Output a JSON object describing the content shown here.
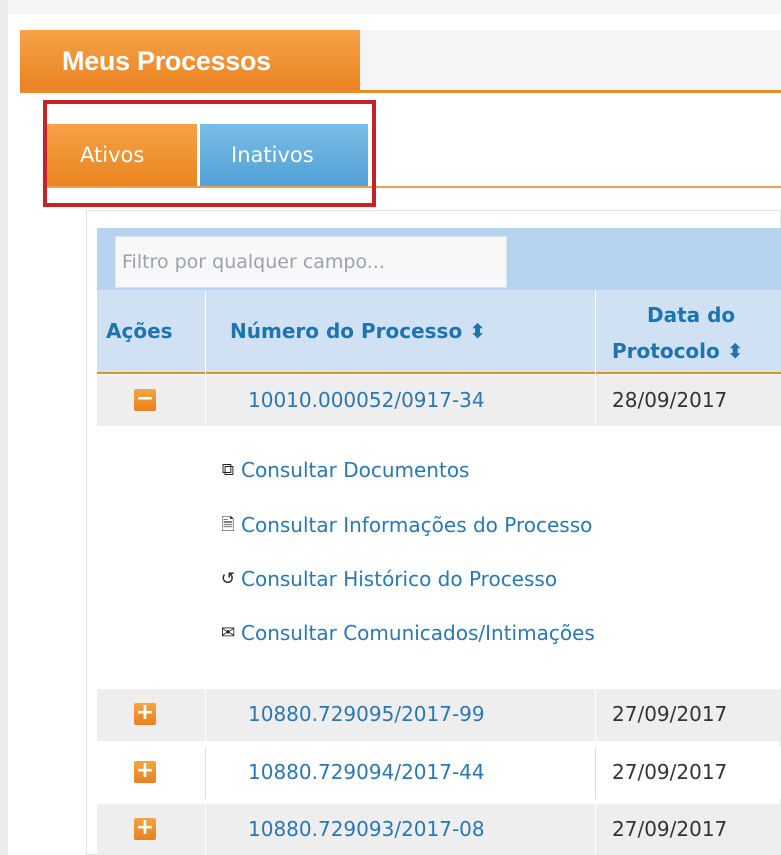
{
  "main_tab": {
    "label": "Meus Processos"
  },
  "tabs": [
    {
      "label": "Ativos",
      "state": "active"
    },
    {
      "label": "Inativos",
      "state": "inactive"
    }
  ],
  "filter": {
    "placeholder": "Filtro por qualquer campo..."
  },
  "table": {
    "headers": {
      "acoes": "Ações",
      "numero": "Número do Processo ⬍",
      "data_line1": "Data do",
      "data_line2": "Protocolo ⬍"
    },
    "rows": [
      {
        "toggle": "−",
        "numero": "10010.000052/0917-34",
        "data": "28/09/2017",
        "expanded": true
      },
      {
        "toggle": "+",
        "numero": "10880.729095/2017-99",
        "data": "27/09/2017",
        "expanded": false
      },
      {
        "toggle": "+",
        "numero": "10880.729094/2017-44",
        "data": "27/09/2017",
        "expanded": false
      },
      {
        "toggle": "+",
        "numero": "10880.729093/2017-08",
        "data": "27/09/2017",
        "expanded": false
      }
    ],
    "actions": [
      {
        "icon": "copy-documents-icon",
        "glyph": "⧉",
        "label": "Consultar Documentos"
      },
      {
        "icon": "document-icon",
        "glyph": "🗎",
        "label": "Consultar Informações do Processo"
      },
      {
        "icon": "history-icon",
        "glyph": "↺",
        "label": "Consultar Histórico do Processo"
      },
      {
        "icon": "envelope-icon",
        "glyph": "✉",
        "label": "Consultar Comunicados/Intimações"
      }
    ]
  },
  "colors": {
    "accent_orange": "#ea8221",
    "tab_blue": "#4f9fd5",
    "header_blue": "#cfe1f2",
    "link_blue": "#2a77b4",
    "highlight_red": "#c7222a"
  }
}
